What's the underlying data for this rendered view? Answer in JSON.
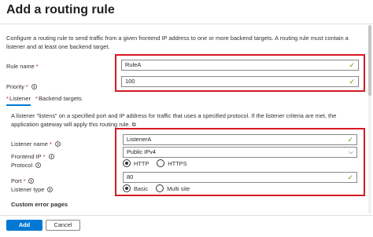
{
  "title": "Add a routing rule",
  "description": "Configure a routing rule to send traffic from a given frontend IP address to one or more backend targets. A routing rule must contain a listener and at least one backend target.",
  "rule_name": {
    "label": "Rule name",
    "required": "*",
    "value": "RuleA"
  },
  "priority": {
    "label": "Priority",
    "required": "*",
    "value": "100"
  },
  "tabs": [
    {
      "label": "Listener",
      "required": "*"
    },
    {
      "label": "Backend targets",
      "required": "*"
    }
  ],
  "listener_description": "A listener \"listens\" on a specified port and IP address for traffic that uses a specified protocol. If the listener criteria are met, the application gateway will apply this routing rule.",
  "listener_name": {
    "label": "Listener name",
    "required": "*",
    "value": "ListenerA"
  },
  "frontend_ip": {
    "label": "Frontend IP",
    "required": "*",
    "value": "Public IPv4"
  },
  "protocol": {
    "label": "Protocol",
    "options": [
      "HTTP",
      "HTTPS"
    ],
    "selected": "HTTP"
  },
  "port": {
    "label": "Port",
    "required": "*",
    "value": "80"
  },
  "listener_type": {
    "label": "Listener type",
    "options": [
      "Basic",
      "Multi site"
    ],
    "selected": "Basic"
  },
  "custom_error_pages": "Custom error pages",
  "buttons": {
    "add": "Add",
    "cancel": "Cancel"
  },
  "colors": {
    "accent": "#0078d4",
    "highlight_box": "#d51a24",
    "valid_check": "#57a300"
  },
  "icons": {
    "valid": "checkmark-icon",
    "dropdown": "chevron-down-icon",
    "info": "info-icon",
    "external": "external-link-icon"
  }
}
